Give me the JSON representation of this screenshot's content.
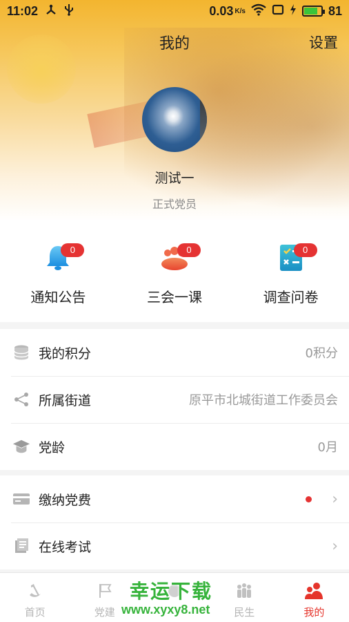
{
  "status_bar": {
    "time": "11:02",
    "speed": "0.03",
    "speed_unit": "K/s",
    "battery": "81",
    "battery_level": 0.81
  },
  "header": {
    "title": "我的",
    "settings_label": "设置"
  },
  "profile": {
    "name": "测试一",
    "role": "正式党员"
  },
  "quick_actions": [
    {
      "label": "通知公告",
      "badge": "0",
      "icon": "bell-icon"
    },
    {
      "label": "三会一课",
      "badge": "0",
      "icon": "meeting-icon"
    },
    {
      "label": "调查问卷",
      "badge": "0",
      "icon": "survey-icon"
    }
  ],
  "info_list": [
    {
      "label": "我的积分",
      "value": "0积分",
      "icon": "coin-stack-icon"
    },
    {
      "label": "所属街道",
      "value": "原平市北城街道工作委员会",
      "icon": "share-icon"
    },
    {
      "label": "党龄",
      "value": "0月",
      "icon": "graduation-cap-icon"
    }
  ],
  "action_list": [
    {
      "label": "缴纳党费",
      "icon": "card-icon",
      "has_dot": true
    },
    {
      "label": "在线考试",
      "icon": "exam-icon",
      "has_dot": false
    }
  ],
  "bottom_nav": [
    {
      "label": "首页",
      "icon": "hammer-sickle-icon",
      "active": false
    },
    {
      "label": "党建",
      "icon": "flag-icon",
      "active": false
    },
    {
      "label": "",
      "icon": "center-icon",
      "active": false
    },
    {
      "label": "民生",
      "icon": "people-icon",
      "active": false
    },
    {
      "label": "我的",
      "icon": "user-icon",
      "active": true
    }
  ],
  "watermark": {
    "line1": "幸运下载",
    "line2": "www.xyxy8.net"
  },
  "colors": {
    "accent": "#e5342b",
    "badge": "#e53333",
    "header_gold": "#f3b52f",
    "watermark": "#36b33b"
  }
}
